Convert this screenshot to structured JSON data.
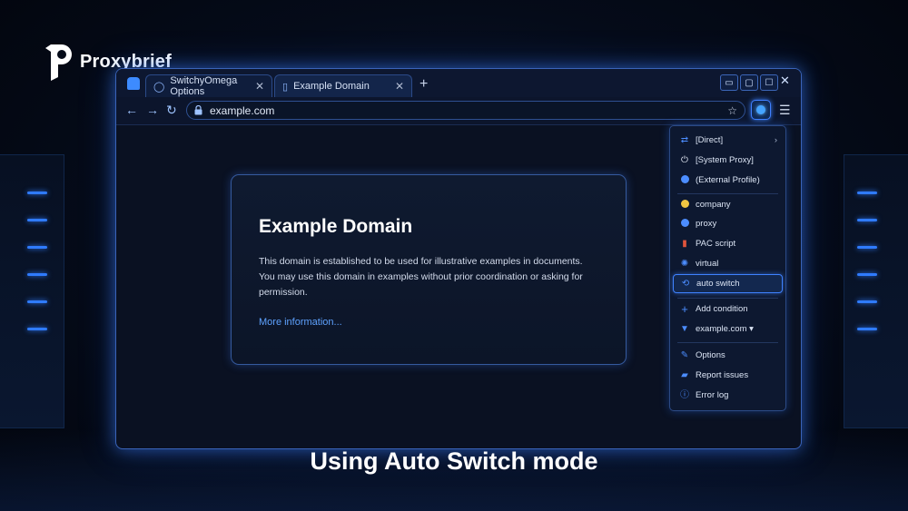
{
  "brand": {
    "logo_text": "Proxybrief"
  },
  "browser": {
    "tabs": [
      {
        "label": "SwitchyOmega Options",
        "icon": "globe-icon"
      },
      {
        "label": "Example Domain",
        "icon": "page-icon"
      }
    ],
    "new_tab_symbol": "+",
    "window_controls": {
      "minimize": "▭",
      "restore": "▢",
      "maximize": "☐",
      "close": "✕"
    },
    "address": "example.com"
  },
  "page": {
    "heading": "Example Domain",
    "paragraph": "This domain is established to be used for illustrative examples in documents. You may use this domain in examples without prior coordination or asking for permission.",
    "link": "More information..."
  },
  "proxy_menu": {
    "items": [
      {
        "label": "[Direct]",
        "icon": "direct-arrows-icon",
        "color": "#4c8dff"
      },
      {
        "label": "[System Proxy]",
        "icon": "power-icon",
        "color": "#e6ecf7"
      },
      {
        "label": "(External Profile)",
        "icon": "external-globe-icon",
        "color": "#4c8dff"
      },
      {
        "label": "company",
        "icon": "company-globe-icon",
        "color": "#f0c542"
      },
      {
        "label": "proxy",
        "icon": "proxy-globe-icon",
        "color": "#4c8dff"
      },
      {
        "label": "PAC script",
        "icon": "pac-file-icon",
        "color": "#e0543c"
      },
      {
        "label": "virtual",
        "icon": "virtual-icon",
        "color": "#4c8dff"
      },
      {
        "label": "auto switch",
        "icon": "auto-switch-icon",
        "color": "#4c8dff",
        "selected": true
      },
      {
        "label": "Add condition",
        "icon": "plus-icon",
        "color": "#4c8dff"
      },
      {
        "label": "example.com ▾",
        "icon": "filter-icon",
        "color": "#4c8dff"
      },
      {
        "label": "Options",
        "icon": "wrench-icon",
        "color": "#4c8dff"
      },
      {
        "label": "Report issues",
        "icon": "chat-icon",
        "color": "#4c8dff"
      },
      {
        "label": "Error log",
        "icon": "info-icon",
        "color": "#4c8dff"
      }
    ]
  },
  "caption": "Using Auto Switch mode",
  "colors": {
    "accent": "#3f82ff",
    "background": "#050b19"
  }
}
